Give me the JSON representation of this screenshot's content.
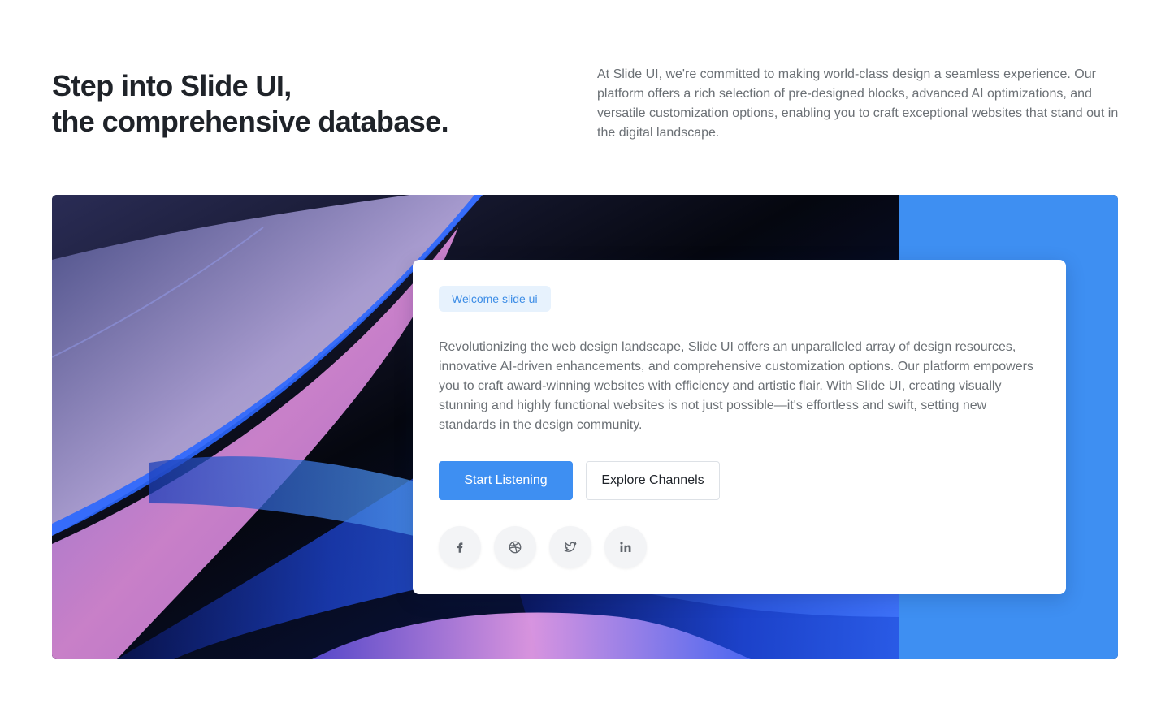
{
  "header": {
    "headline_line1": "Step into Slide UI,",
    "headline_line2": "the comprehensive database.",
    "intro": "At Slide UI, we're committed to making world-class design a seamless experience. Our platform offers a rich selection of pre-designed blocks, advanced AI optimizations, and versatile customization options, enabling you to craft exceptional websites that stand out in the digital landscape."
  },
  "card": {
    "badge": "Welcome slide ui",
    "body": "Revolutionizing the web design landscape, Slide UI offers an unparalleled array of design resources, innovative AI-driven enhancements, and comprehensive customization options. Our platform empowers you to craft award-winning websites with efficiency and artistic flair. With Slide UI, creating visually stunning and highly functional websites is not just possible—it's effortless and swift, setting new standards in the design community.",
    "primary_button": "Start Listening",
    "secondary_button": "Explore Channels",
    "socials": [
      {
        "icon": "facebook-icon"
      },
      {
        "icon": "dribbble-icon"
      },
      {
        "icon": "twitter-icon"
      },
      {
        "icon": "linkedin-icon"
      }
    ]
  },
  "colors": {
    "accent": "#3e8ff2",
    "badge_bg": "#e7f2fd",
    "badge_text": "#3d8de6",
    "heading": "#1f2329",
    "body_text": "#6b7075"
  }
}
